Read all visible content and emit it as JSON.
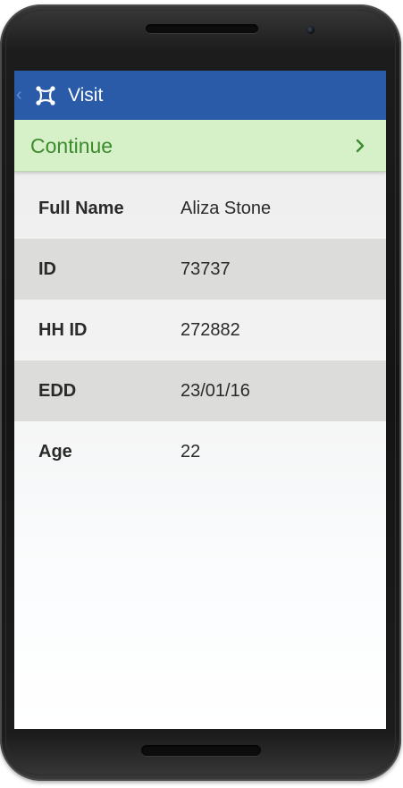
{
  "app_bar": {
    "title": "Visit",
    "icon": "app-logo-icon",
    "color": "#2a5ba8"
  },
  "continue_bar": {
    "label": "Continue",
    "icon": "chevron-right-icon",
    "background": "#d6f0c8",
    "text_color": "#3d8b2f"
  },
  "details": [
    {
      "label": "Full Name",
      "value": "Aliza Stone"
    },
    {
      "label": "ID",
      "value": "73737"
    },
    {
      "label": "HH ID",
      "value": "272882"
    },
    {
      "label": "EDD",
      "value": "23/01/16"
    },
    {
      "label": "Age",
      "value": "22"
    }
  ]
}
